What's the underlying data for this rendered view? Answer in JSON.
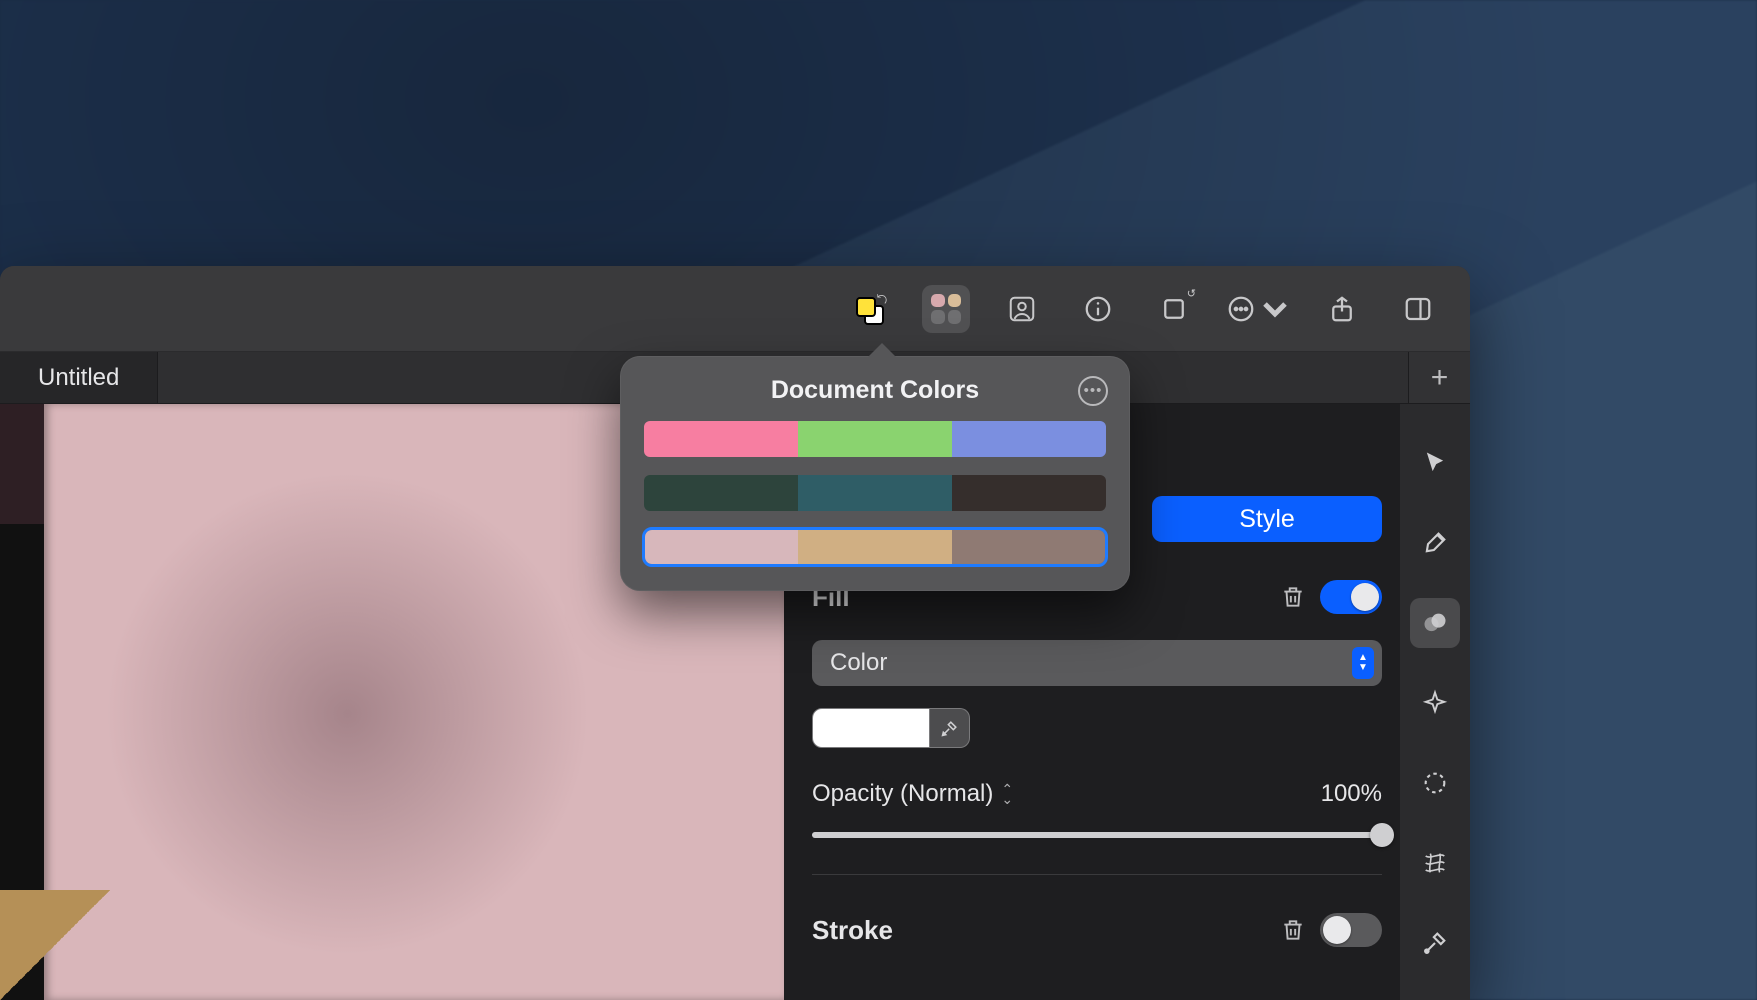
{
  "documentTitle": "Untitled",
  "toolbar": {
    "foregroundColor": "#ffe23a",
    "backgroundColor": "#ffffff"
  },
  "popover": {
    "title": "Document Colors",
    "palettes": [
      {
        "selected": false,
        "colors": [
          "#f77ea1",
          "#8ad36f",
          "#7b8fe0"
        ]
      },
      {
        "selected": false,
        "colors": [
          "#2d443c",
          "#2f5d66",
          "#352e2c"
        ]
      },
      {
        "selected": true,
        "colors": [
          "#d7b7bb",
          "#d0af83",
          "#8f7a73"
        ]
      }
    ]
  },
  "inspector": {
    "styleButton": "Style",
    "fill": {
      "label": "Fill",
      "enabled": true,
      "typeLabel": "Color",
      "colorValue": "#ffffff",
      "opacityLabel": "Opacity (Normal)",
      "opacityValue": "100%",
      "opacityPercent": 100
    },
    "stroke": {
      "label": "Stroke",
      "enabled": false
    }
  }
}
